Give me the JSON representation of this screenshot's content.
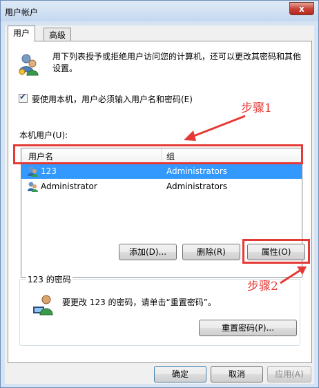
{
  "window": {
    "title": "用户帐户",
    "close_label": "x"
  },
  "tabs": [
    {
      "label": "用户"
    },
    {
      "label": "高级"
    }
  ],
  "intro_text": "用下列表授予或拒绝用户访问您的计算机，还可以更改其密码和其他设置。",
  "require_login": {
    "label": "要使用本机，用户必须输入用户名和密码(E)",
    "checked": true
  },
  "local_users": {
    "label": "本机用户(U):",
    "columns": [
      "用户名",
      "组"
    ],
    "rows": [
      {
        "name": "123",
        "group": "Administrators",
        "selected": true
      },
      {
        "name": "Administrator",
        "group": "Administrators",
        "selected": false
      }
    ]
  },
  "buttons": {
    "add": "添加(D)...",
    "remove": "删除(R)",
    "properties": "属性(O)"
  },
  "password_group": {
    "title": "123 的密码",
    "text": "要更改 123 的密码，请单击“重置密码”。",
    "reset_label": "重置密码(P)..."
  },
  "footer": {
    "ok": "确定",
    "cancel": "取消",
    "apply": "应用(A)"
  },
  "annotations": {
    "step1": "步骤1",
    "step2": "步骤2",
    "color": "#e53935"
  }
}
